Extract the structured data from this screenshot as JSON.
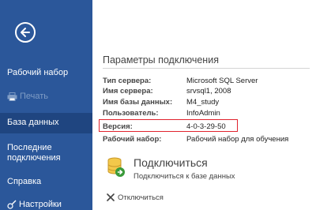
{
  "sidebar": {
    "back_icon": "arrow-left-circle-icon",
    "items": [
      {
        "label": "Рабочий набор",
        "state": "normal"
      },
      {
        "label": "Печать",
        "state": "disabled",
        "icon": "printer-icon"
      },
      {
        "label": "База данных",
        "state": "selected"
      },
      {
        "label": "Последние подключения",
        "state": "normal"
      },
      {
        "label": "Справка",
        "state": "normal"
      },
      {
        "label": "Настройки",
        "state": "normal",
        "icon": "settings-icon"
      }
    ]
  },
  "main": {
    "section_title": "Параметры подключения",
    "properties": [
      {
        "label": "Тип сервера:",
        "value": "Microsoft SQL Server"
      },
      {
        "label": "Имя сервера:",
        "value": "srvsql1, 2008"
      },
      {
        "label": "Имя базы данных:",
        "value": "M4_study"
      },
      {
        "label": "Пользователь:",
        "value": "InfoAdmin"
      },
      {
        "label": "Версия:",
        "value": "4-0-3-29-50"
      },
      {
        "label": "Рабочий набор:",
        "value": "Рабочий набор для обучения"
      }
    ],
    "connect": {
      "title": "Подключиться",
      "subtitle": "Подключиться к базе данных",
      "icon": "database-connect-icon"
    },
    "disconnect": {
      "label": "Отключиться",
      "icon": "close-x-icon"
    }
  },
  "colors": {
    "sidebar_bg": "#2b579a",
    "sidebar_selected": "#1f4580",
    "highlight_border": "#e0242e"
  }
}
